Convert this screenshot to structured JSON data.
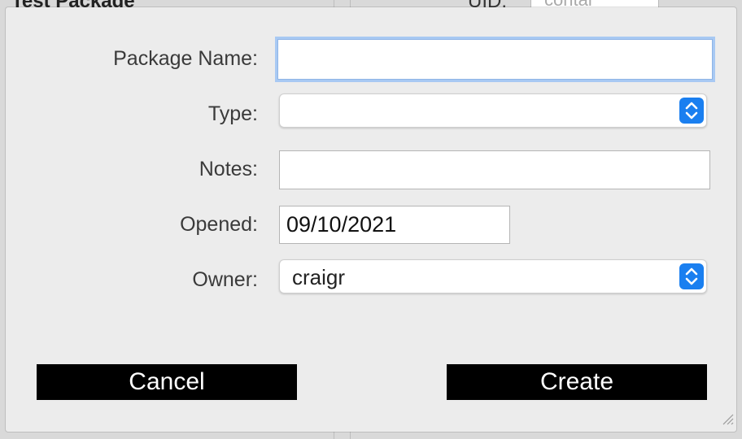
{
  "background_window": {
    "title": "Test Package",
    "uid_label": "UID:",
    "uid_value": "contai"
  },
  "form": {
    "package_name": {
      "label": "Package Name:",
      "value": ""
    },
    "type": {
      "label": "Type:",
      "value": ""
    },
    "notes": {
      "label": "Notes:",
      "value": ""
    },
    "opened": {
      "label": "Opened:",
      "value": "09/10/2021"
    },
    "owner": {
      "label": "Owner:",
      "value": "craigr"
    }
  },
  "buttons": {
    "cancel": "Cancel",
    "create": "Create"
  },
  "colors": {
    "focus_ring": "#a8c9f3",
    "stepper_accent": "#1a7ff0",
    "button_bg": "#000000"
  },
  "icons": [
    "updown-chevron-icon",
    "resize-grip-icon"
  ]
}
